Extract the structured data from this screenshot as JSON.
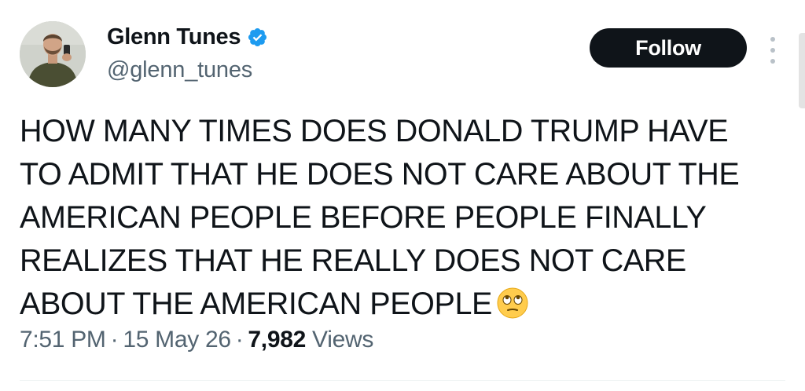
{
  "author": {
    "display_name": "Glenn Tunes",
    "handle": "@glenn_tunes",
    "verified": true,
    "avatar_icon": "profile-photo"
  },
  "actions": {
    "follow_label": "Follow",
    "more_icon": "vertical-ellipsis-icon"
  },
  "tweet": {
    "lines": [
      "HOW MANY TIMES DOES DONALD TRUMP HAVE",
      "TO ADMIT THAT HE DOES NOT CARE ABOUT THE",
      "AMERICAN PEOPLE BEFORE PEOPLE FINALLY",
      "REALIZES THAT HE REALLY DOES NOT CARE",
      "ABOUT THE AMERICAN PEOPLE"
    ],
    "emoji": "face-with-rolling-eyes"
  },
  "meta": {
    "time": "7:51 PM",
    "date": "15 May 26",
    "views_count": "7,982",
    "views_label": "Views"
  },
  "colors": {
    "text_primary": "#0f1419",
    "text_secondary": "#536471",
    "verified_blue": "#1d9bf0",
    "follow_bg": "#0f1419"
  }
}
